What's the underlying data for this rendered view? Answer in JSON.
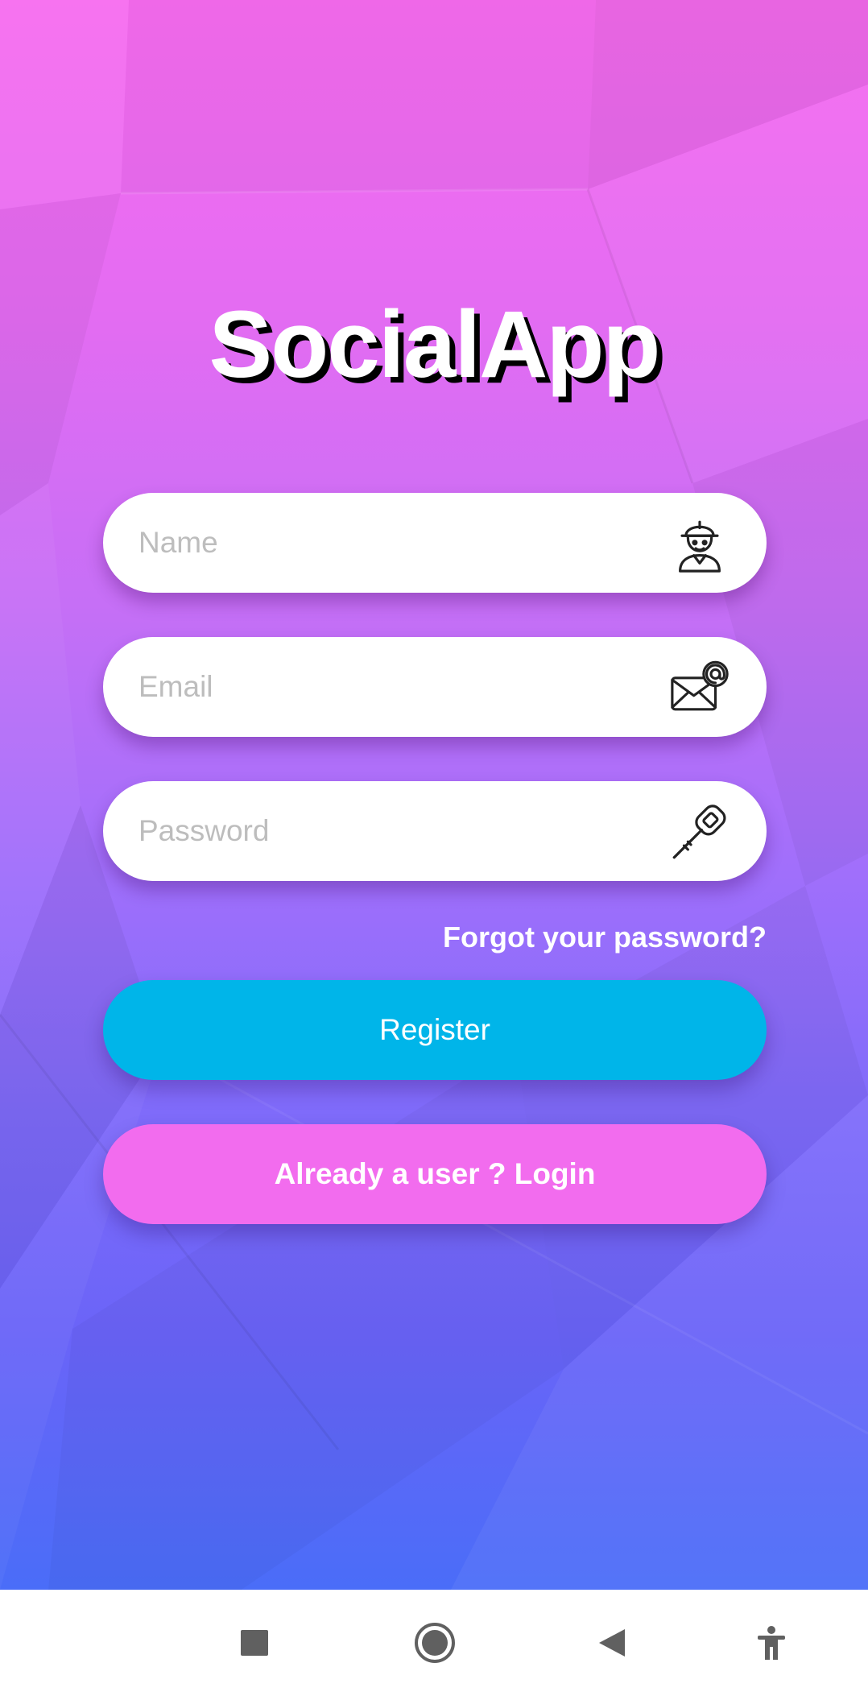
{
  "app": {
    "title": "SocialApp"
  },
  "form": {
    "name": {
      "placeholder": "Name",
      "value": "",
      "icon": "worker-avatar-icon"
    },
    "email": {
      "placeholder": "Email",
      "value": "",
      "icon": "mail-at-icon"
    },
    "password": {
      "placeholder": "Password",
      "value": "",
      "icon": "key-icon"
    },
    "forgot_label": "Forgot your password?",
    "register_label": "Register",
    "login_label": "Already a user ? Login"
  },
  "navbar": {
    "items": [
      "recents-icon",
      "home-icon",
      "back-icon",
      "accessibility-icon"
    ]
  },
  "colors": {
    "gradient_top": "#f76cf0",
    "gradient_bottom": "#4a6df8",
    "register": "#00b5e9",
    "login": "#f26cee",
    "navbar": "#ffffff"
  }
}
